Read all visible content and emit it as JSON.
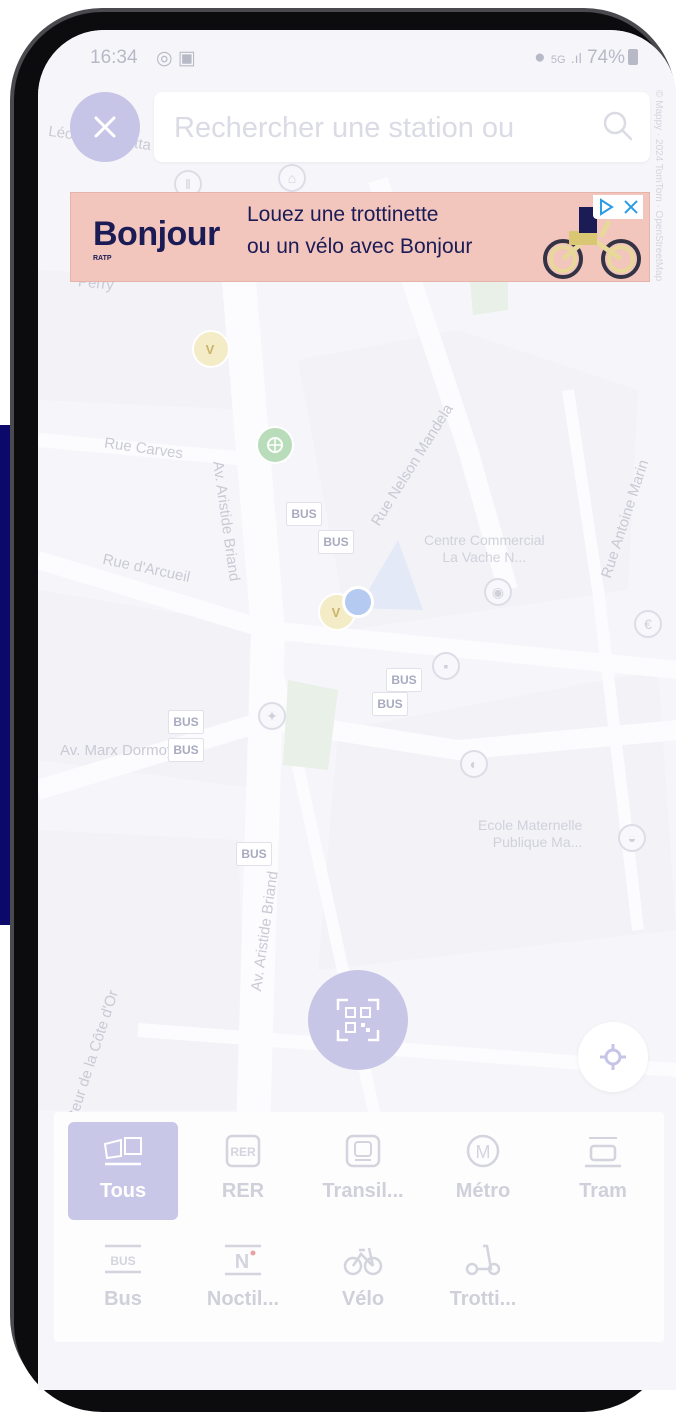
{
  "status_bar": {
    "time": "16:34",
    "network": "5G",
    "battery": "74%"
  },
  "search": {
    "placeholder": "Rechercher une station ou"
  },
  "ad": {
    "brand": "Bonjour",
    "brand_sub": "RATP",
    "line1": "Louez une trottinette",
    "line2": "ou un vélo avec Bonjour"
  },
  "map": {
    "streets": [
      {
        "id": "gambetta",
        "text": "Léon Gambetta"
      },
      {
        "id": "perry",
        "text": "Perry"
      },
      {
        "id": "carves",
        "text": "Rue Carves"
      },
      {
        "id": "arcueil",
        "text": "Rue d'Arcueil"
      },
      {
        "id": "briand1",
        "text": "Av. Aristide Briand"
      },
      {
        "id": "mandela",
        "text": "Rue Nelson Mandela"
      },
      {
        "id": "marin",
        "text": "Rue Antoine Marin"
      },
      {
        "id": "marxdormoy",
        "text": "Av. Marx Dormoy"
      },
      {
        "id": "briand2",
        "text": "Av. Aristide Briand"
      },
      {
        "id": "cotedor",
        "text": "Av. Pasteur de la Côte d'Or"
      }
    ],
    "pois": {
      "centre_commercial": {
        "line1": "Centre Commercial",
        "line2": "La Vache N..."
      },
      "ecole": {
        "line1": "Ecole Maternelle",
        "line2": "Publique Ma..."
      }
    },
    "bus_label": "BUS",
    "attribution": "© Mappy · 2024 TomTom · OpenStreetMap"
  },
  "filters": [
    {
      "id": "tous",
      "label": "Tous",
      "icon": "all-modes-icon",
      "active": true
    },
    {
      "id": "rer",
      "label": "RER",
      "icon": "rer-icon",
      "active": false
    },
    {
      "id": "transilien",
      "label": "Transil...",
      "icon": "train-icon",
      "active": false
    },
    {
      "id": "metro",
      "label": "Métro",
      "icon": "metro-icon",
      "active": false
    },
    {
      "id": "tram",
      "label": "Tram",
      "icon": "tram-icon",
      "active": false
    },
    {
      "id": "bus",
      "label": "Bus",
      "icon": "bus-icon",
      "active": false
    },
    {
      "id": "noctilien",
      "label": "Noctil...",
      "icon": "noctilien-icon",
      "active": false
    },
    {
      "id": "velo",
      "label": "Vélo",
      "icon": "bike-icon",
      "active": false
    },
    {
      "id": "trottinette",
      "label": "Trotti...",
      "icon": "scooter-icon",
      "active": false
    }
  ],
  "icon_labels": {
    "rer": "RER",
    "metro": "M",
    "bus": "BUS",
    "noctilien": "N"
  },
  "colors": {
    "accent": "#c9c7e7",
    "navy": "#1b1b55",
    "ad_bg": "#f2c5bd",
    "edge_blue": "#0b0a6b"
  }
}
